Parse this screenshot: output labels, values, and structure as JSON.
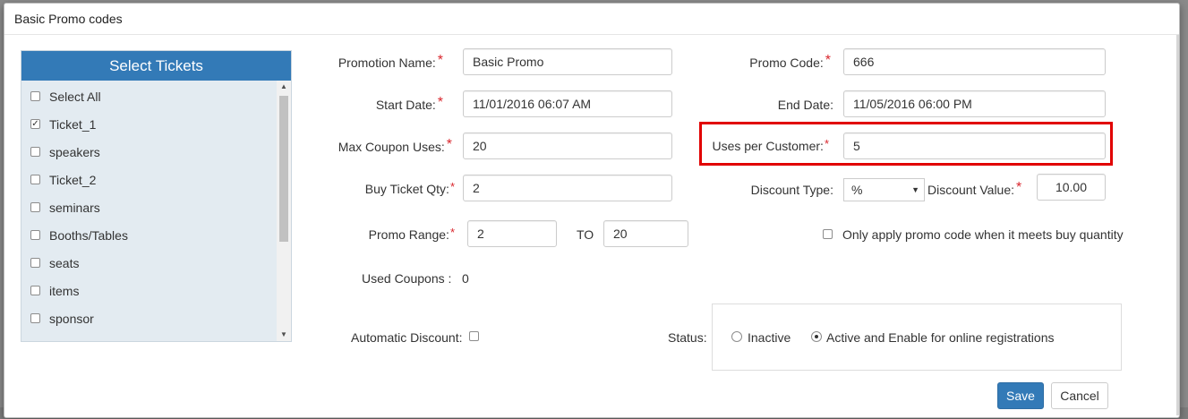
{
  "modal": {
    "title": "Basic Promo codes"
  },
  "tickets": {
    "header": "Select Tickets",
    "items": [
      {
        "label": "Select All",
        "checked": false
      },
      {
        "label": "Ticket_1",
        "checked": true
      },
      {
        "label": "speakers",
        "checked": false
      },
      {
        "label": "Ticket_2",
        "checked": false
      },
      {
        "label": "seminars",
        "checked": false
      },
      {
        "label": "Booths/Tables",
        "checked": false
      },
      {
        "label": "seats",
        "checked": false
      },
      {
        "label": "items",
        "checked": false
      },
      {
        "label": "sponsor",
        "checked": false
      }
    ]
  },
  "form": {
    "promotion_name": {
      "label": "Promotion Name:",
      "value": "Basic Promo"
    },
    "promo_code": {
      "label": "Promo Code:",
      "value": "666"
    },
    "start_date": {
      "label": "Start Date:",
      "value": "11/01/2016 06:07 AM"
    },
    "end_date": {
      "label": "End Date:",
      "value": "11/05/2016 06:00 PM"
    },
    "max_coupon_uses": {
      "label": "Max Coupon Uses:",
      "value": "20"
    },
    "uses_per_customer": {
      "label": "Uses per Customer:",
      "value": "5"
    },
    "buy_ticket_qty": {
      "label": "Buy Ticket Qty:",
      "value": "2"
    },
    "discount_type": {
      "label": "Discount Type:",
      "value": "%"
    },
    "discount_value": {
      "label": "Discount Value:",
      "value": "10.00"
    },
    "promo_range": {
      "label": "Promo Range:",
      "from": "2",
      "to_label": "TO",
      "to": "20"
    },
    "only_apply": {
      "label": "Only apply promo code when it meets buy quantity",
      "checked": false
    },
    "used_coupons": {
      "label": "Used Coupons :",
      "value": "0"
    },
    "automatic_discount": {
      "label": "Automatic Discount:",
      "checked": false
    },
    "status": {
      "label": "Status:",
      "options": [
        {
          "label": "Inactive",
          "selected": false
        },
        {
          "label": "Active and Enable for online registrations",
          "selected": true
        }
      ]
    }
  },
  "buttons": {
    "save": "Save",
    "cancel": "Cancel"
  },
  "colors": {
    "primary": "#337ab7",
    "required": "#d9262d",
    "highlight": "#e10000",
    "panel_bg": "#e3ebf1"
  }
}
